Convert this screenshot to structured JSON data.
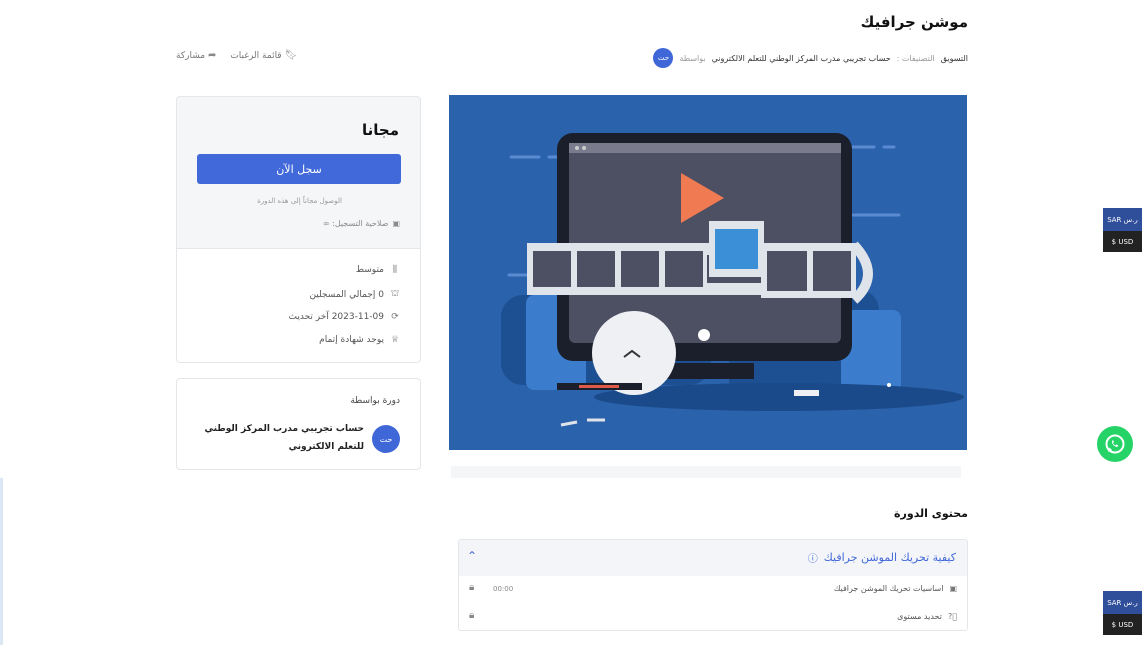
{
  "course": {
    "title": "موشن جرافيك",
    "by_label": "بواسطة",
    "author": "حساب تجريبي مدرب المركز الوطني للتعلم الالكتروني",
    "categories_label": "التصنيفات :",
    "category": "التسويق",
    "avatar_initials": "حت"
  },
  "actions": {
    "wishlist": "قائمة الرغبات",
    "share": "مشاركة"
  },
  "sidebar": {
    "price": "مجانا",
    "enroll": "سجل الآن",
    "free_note": "الوصول مجاناً إلى هذه الدورة",
    "validity": "صلاحية التسجيل: ∞",
    "meta": [
      {
        "icon": "level-icon",
        "text": "متوسط"
      },
      {
        "icon": "students-icon",
        "text": "0 إجمالي المسجلين"
      },
      {
        "icon": "update-icon",
        "text": "2023-11-09 آخر تحديث"
      },
      {
        "icon": "certificate-icon",
        "text": "يوجد شهادة إتمام"
      }
    ]
  },
  "instructor": {
    "heading": "دورة بواسطة",
    "initials": "حت",
    "name": "حساب تجريبي مدرب المركز الوطني للتعلم الالكتروني"
  },
  "content": {
    "heading": "محتوى الدورة",
    "topic_title": "كيفية تحريك الموشن جرافيك",
    "lessons": [
      {
        "title": "اساسيات تحريك الموشن جرافيك",
        "duration": "00:00",
        "icon": "video-icon"
      },
      {
        "title": "تحديد مستوى",
        "duration": "",
        "icon": "quiz-icon"
      }
    ]
  },
  "currency": {
    "sar": "SAR ر.س",
    "usd": "$ USD"
  },
  "colors": {
    "accent": "#4269d9",
    "thumbnail_bg": "#2a62ab",
    "whatsapp": "#25d366"
  }
}
